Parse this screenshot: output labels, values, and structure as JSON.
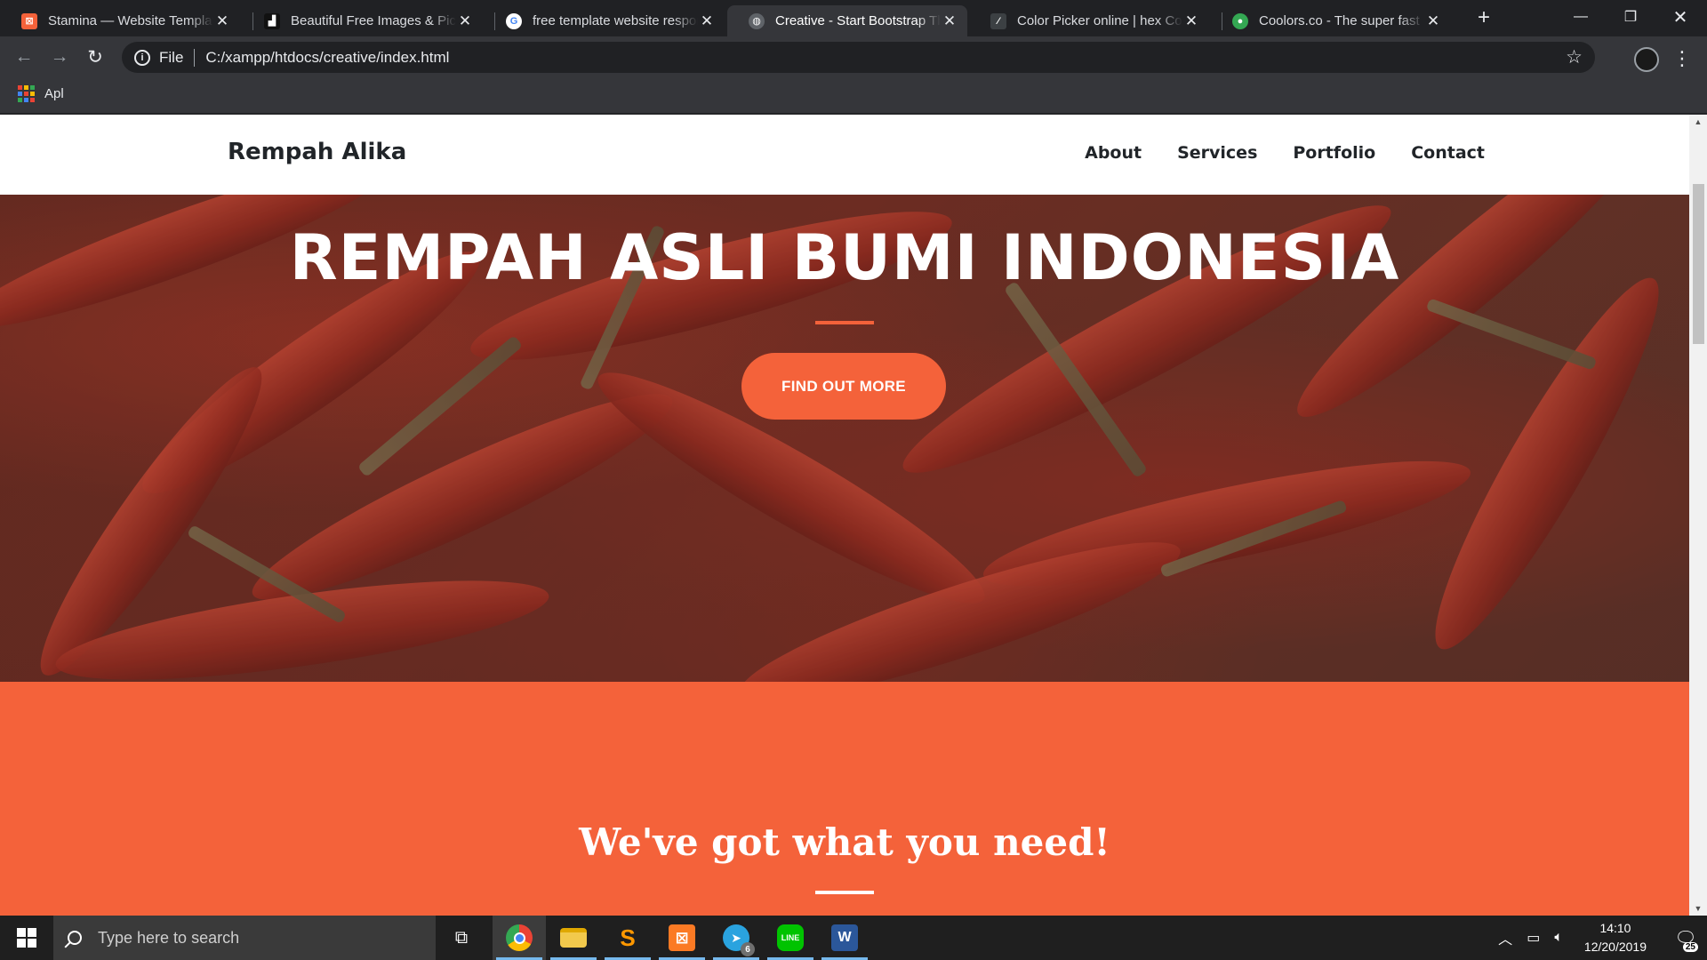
{
  "browser": {
    "tabs": [
      {
        "title": "Stamina — Website Template",
        "favicon_color": "#f4623a",
        "active": false
      },
      {
        "title": "Beautiful Free Images & Pictures",
        "favicon_color": "#111111",
        "active": false
      },
      {
        "title": "free template website responsive",
        "favicon_color": "#4285f4",
        "active": false
      },
      {
        "title": "Creative - Start Bootstrap Theme",
        "favicon_color": "#5f6368",
        "active": true
      },
      {
        "title": "Color Picker online | hex Color",
        "favicon_color": "#3c4043",
        "active": false
      },
      {
        "title": "Coolors.co - The super fast color",
        "favicon_color": "#34a853",
        "active": false
      }
    ],
    "address": {
      "scheme": "File",
      "url": "C:/xampp/htdocs/creative/index.html"
    },
    "bookmarks": [
      {
        "label": "Apl"
      }
    ]
  },
  "site": {
    "brand": "Rempah Alika",
    "nav": [
      "About",
      "Services",
      "Portfolio",
      "Contact"
    ],
    "hero": {
      "title": "REMPAH ASLI BUMI INDONESIA",
      "button": "FIND OUT MORE"
    },
    "services": {
      "title": "We've got what you need!"
    }
  },
  "taskbar": {
    "search_placeholder": "Type here to search",
    "apps": [
      {
        "name": "chrome",
        "color": "#4285f4",
        "active": true
      },
      {
        "name": "file-explorer",
        "color": "#f2c94c",
        "active": false
      },
      {
        "name": "sublime-text",
        "color": "#ff9800",
        "active": false
      },
      {
        "name": "xampp",
        "color": "#fb7a24",
        "active": false
      },
      {
        "name": "telegram",
        "color": "#2aa3df",
        "badge": "6",
        "active": false
      },
      {
        "name": "line",
        "color": "#00c300",
        "active": false
      },
      {
        "name": "word",
        "color": "#2b579a",
        "active": false
      }
    ],
    "clock": {
      "time": "14:10",
      "date": "12/20/2019"
    },
    "notifications_count": "25"
  },
  "colors": {
    "accent": "#f4623a",
    "chrome_dark": "#202124",
    "chrome_toolbar": "#35363a"
  }
}
